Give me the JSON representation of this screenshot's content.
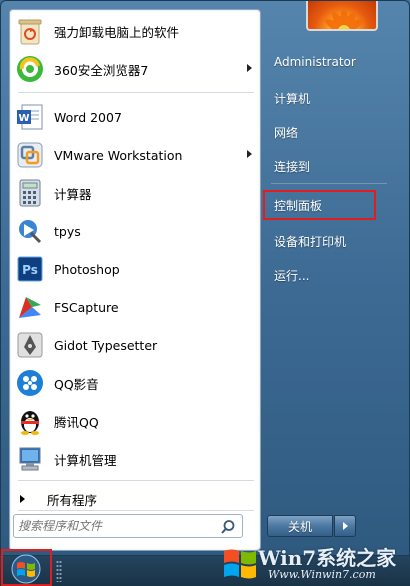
{
  "user": {
    "name": "Administrator"
  },
  "pinned_programs": [
    {
      "label": "强力卸载电脑上的软件",
      "icon": "recycle-bin-icon",
      "submenu": false
    },
    {
      "label": "360安全浏览器7",
      "icon": "360-browser-icon",
      "submenu": true
    }
  ],
  "recent_programs": [
    {
      "label": "Word 2007",
      "icon": "word-icon",
      "submenu": false
    },
    {
      "label": "VMware Workstation",
      "icon": "vmware-icon",
      "submenu": true
    },
    {
      "label": "计算器",
      "icon": "calculator-icon",
      "submenu": false
    },
    {
      "label": "tpys",
      "icon": "tpys-icon",
      "submenu": false
    },
    {
      "label": "Photoshop",
      "icon": "photoshop-icon",
      "submenu": false
    },
    {
      "label": "FSCapture",
      "icon": "fscapture-icon",
      "submenu": false
    },
    {
      "label": "Gidot Typesetter",
      "icon": "gidot-pen-icon",
      "submenu": false
    },
    {
      "label": "QQ影音",
      "icon": "qq-player-icon",
      "submenu": false
    },
    {
      "label": "腾讯QQ",
      "icon": "qq-penguin-icon",
      "submenu": false
    },
    {
      "label": "计算机管理",
      "icon": "computer-management-icon",
      "submenu": false
    }
  ],
  "all_programs": {
    "label": "所有程序"
  },
  "search": {
    "placeholder": "搜索程序和文件"
  },
  "right_links": [
    {
      "label": "Administrator",
      "name": "right-item-administrator"
    },
    {
      "label": "计算机",
      "name": "right-item-computer"
    },
    {
      "label": "网络",
      "name": "right-item-network"
    },
    {
      "label": "连接到",
      "name": "right-item-connect-to"
    },
    {
      "label": "控制面板",
      "name": "right-item-control-panel"
    },
    {
      "label": "设备和打印机",
      "name": "right-item-devices-printers"
    },
    {
      "label": "运行...",
      "name": "right-item-run"
    }
  ],
  "shutdown": {
    "label": "关机"
  },
  "watermark": {
    "brand": "Win7系统之家",
    "url": "Www.Winwin7.com"
  },
  "colors": {
    "highlight": "#e11e1e",
    "menu_blue": "#3d6b94",
    "taskbar": "#1f3c54"
  }
}
